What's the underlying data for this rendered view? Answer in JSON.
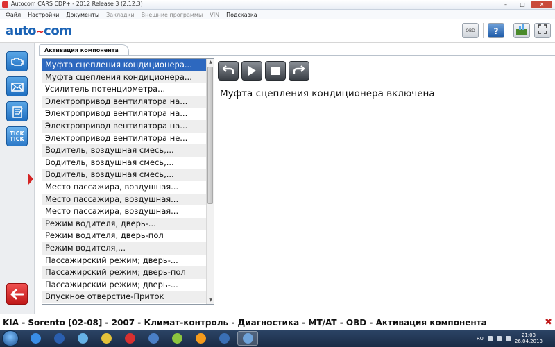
{
  "window": {
    "title": "Autocom CARS CDP+ - 2012 Release 3 (2.12.3)",
    "buttons": {
      "minimize": "–",
      "maximize": "□",
      "close": "✕"
    }
  },
  "menu": [
    {
      "label": "Файл",
      "enabled": true
    },
    {
      "label": "Настройки",
      "enabled": true
    },
    {
      "label": "Документы",
      "enabled": true
    },
    {
      "label": "Закладки",
      "enabled": false
    },
    {
      "label": "Внешние программы",
      "enabled": false
    },
    {
      "label": "VIN",
      "enabled": false
    },
    {
      "label": "Подсказка",
      "enabled": true
    }
  ],
  "logo": {
    "left": "auto",
    "mid": "~",
    "right": "com"
  },
  "toolbar": {
    "obd_icon": "OBD",
    "help_icon": "?"
  },
  "leftnav": {
    "items": [
      {
        "icon": "engine-icon",
        "active": false
      },
      {
        "icon": "envelope-icon",
        "active": false
      },
      {
        "icon": "notepad-icon",
        "active": false
      },
      {
        "icon": "tick-tick-icon",
        "label": "TICK TICK",
        "active": true
      }
    ],
    "back_icon": "back-arrow-icon"
  },
  "tab": {
    "label": "Активация компонента"
  },
  "list": {
    "selected_index": 0,
    "items": [
      "Муфта сцепления кондиционера...",
      "Муфта сцепления кондиционера...",
      "Усилитель потенциометра...",
      "Электропривод вентилятора на...",
      "Электропривод вентилятора на...",
      "Электропривод вентилятора на...",
      "Электропривод вентилятора не...",
      "Водитель, воздушная смесь,...",
      "Водитель, воздушная смесь,...",
      "Водитель, воздушная смесь,...",
      "Место пассажира, воздушная...",
      "Место пассажира, воздушная...",
      "Место пассажира, воздушная...",
      "Режим водителя, дверь-...",
      "Режим водителя, дверь-пол",
      "Режим водителя,...",
      "Пассажирский режим; дверь-...",
      "Пассажирский режим; дверь-пол",
      "Пассажирский режим; дверь-...",
      "Впускное отверстие-Приток"
    ]
  },
  "controls": [
    {
      "name": "undo-button",
      "icon": "undo-arrow-icon"
    },
    {
      "name": "play-button",
      "icon": "play-icon"
    },
    {
      "name": "stop-button",
      "icon": "stop-icon"
    },
    {
      "name": "redo-button",
      "icon": "redo-arrow-icon"
    }
  ],
  "status_text": "Муфта сцепления кондиционера включена",
  "breadcrumb": "KIA - Sorento [02-08] - 2007 - Климат-контроль - Диагностика - MT/AT - OBD - Активация компонента",
  "taskbar": {
    "apps": [
      {
        "name": "taskbar-ie-icon",
        "color": "#3a8ee6",
        "active": false
      },
      {
        "name": "taskbar-app-icon",
        "color": "#2a5fb0",
        "active": false
      },
      {
        "name": "taskbar-media-icon",
        "color": "#66b2e6",
        "active": false
      },
      {
        "name": "taskbar-chrome-icon",
        "color": "#e3c23a",
        "active": false
      },
      {
        "name": "taskbar-yandex-icon",
        "color": "#d83030",
        "active": false
      },
      {
        "name": "taskbar-app2-icon",
        "color": "#4a7fc6",
        "active": false
      },
      {
        "name": "taskbar-app3-icon",
        "color": "#8cc63f",
        "active": false
      },
      {
        "name": "taskbar-ok-icon",
        "color": "#f59b1c",
        "active": false
      },
      {
        "name": "taskbar-app4-icon",
        "color": "#3a6fb5",
        "active": false
      },
      {
        "name": "taskbar-autocom-icon",
        "color": "#6fa3da",
        "active": true
      }
    ],
    "lang": "RU",
    "time": "21:03",
    "date": "26.04.2013"
  }
}
